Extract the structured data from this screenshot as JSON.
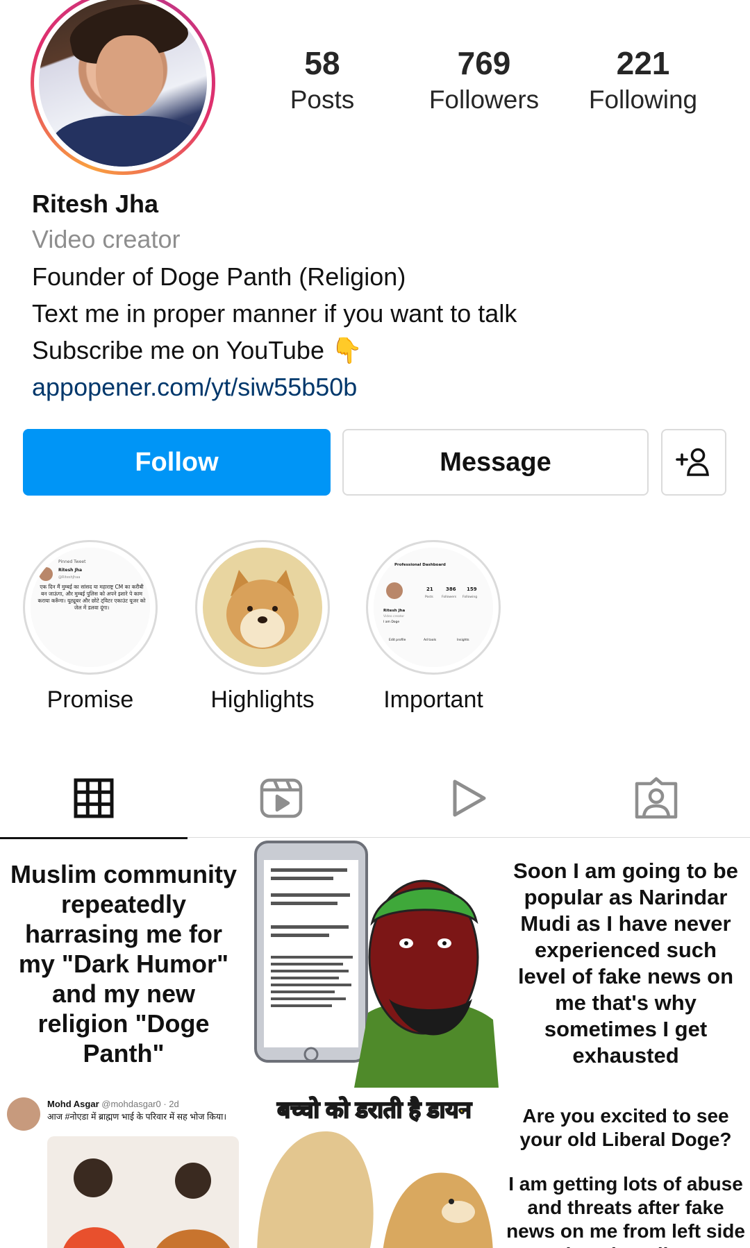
{
  "profile": {
    "name": "Ritesh Jha",
    "category": "Video creator",
    "bio_lines": [
      "Founder of Doge Panth (Religion)",
      "Text me in proper manner if you want to talk",
      "Subscribe me on YouTube 👇"
    ],
    "link": "appopener.com/yt/siw55b50b"
  },
  "stats": [
    {
      "value": "58",
      "label": "Posts"
    },
    {
      "value": "769",
      "label": "Followers"
    },
    {
      "value": "221",
      "label": "Following"
    }
  ],
  "actions": {
    "follow_label": "Follow",
    "message_label": "Message",
    "add_icon": "add-person-icon"
  },
  "highlights": [
    {
      "label": "Promise"
    },
    {
      "label": "Highlights"
    },
    {
      "label": "Important"
    }
  ],
  "highlight_thumbs": {
    "promise": {
      "pinned": "Pinned Tweet",
      "name": "Ritesh Jha",
      "handle": "@RiteshJhaa",
      "text": "एक दिन मैं मुम्बई का सांसद या महाराष्ट्र CM का करीबी बन जाऊंगा, और मुम्बई पुलिस को अपने इशारे पे काम कराया करूँगा। यूट्यूबर और छोटे ट्विटर एकाउंट यूजर को जेल में डलवा दूंगा।"
    },
    "important": {
      "title": "Professional Dashboard",
      "posts": "21",
      "followers": "386",
      "following": "159",
      "posts_label": "Posts",
      "followers_label": "Followers",
      "following_label": "Following",
      "name": "Ritesh Jha",
      "category": "Video creator",
      "bio": "I am Doge",
      "btn1": "Edit profile",
      "btn2": "Ad tools",
      "btn3": "Insights"
    }
  },
  "tabs": [
    {
      "icon": "grid-icon",
      "active": true
    },
    {
      "icon": "reels-icon",
      "active": false
    },
    {
      "icon": "video-play-icon",
      "active": false
    },
    {
      "icon": "tagged-person-icon",
      "active": false
    }
  ],
  "posts": {
    "p1_text": "Muslim community repeatedly harrasing me for my \"Dark Humor\" and my new religion \"Doge Panth\"",
    "p3_text": "Soon I am going to be popular as Narindar Mudi as I have never experienced such level of fake news on me that's why sometimes I get exhausted",
    "p4_user": "Mohd Asgar",
    "p4_handle": "@mohdasgar0 · 2d",
    "p4_text": "आज #नोएडा में ब्राह्मण भाई के परिवार में सह भोज किया।",
    "p5_text": "बच्चो को डराती है डायन",
    "p6_text_1": "Are you excited to see your old Liberal Doge?",
    "p6_text_2": "I am getting lots of abuse and threats after fake news on me from left side lyo oh mujhe"
  },
  "colors": {
    "follow_blue": "#0095f6",
    "link_blue": "#00376b",
    "muted_gray": "#8e8e8e",
    "border_gray": "#dbdbdb"
  }
}
